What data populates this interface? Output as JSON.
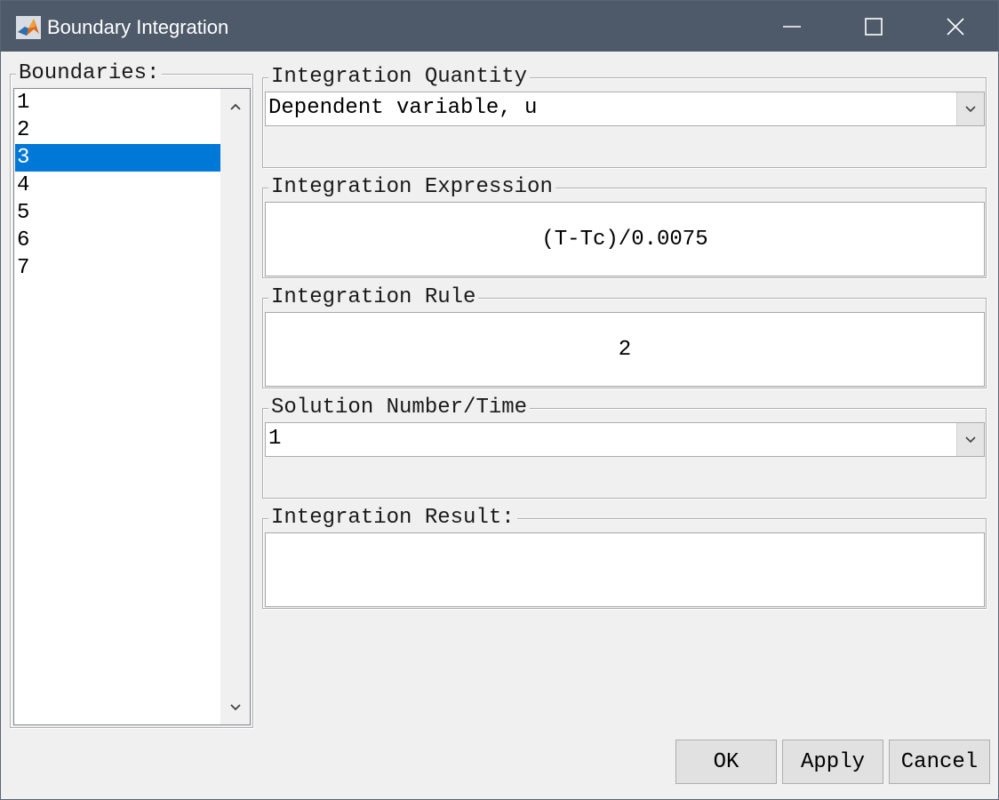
{
  "window": {
    "title": "Boundary Integration",
    "icon": "matlab-icon"
  },
  "boundaries": {
    "title": "Boundaries:",
    "items": [
      "1",
      "2",
      "3",
      "4",
      "5",
      "6",
      "7"
    ],
    "selected": "3"
  },
  "integration_quantity": {
    "title": "Integration Quantity",
    "value": "Dependent variable, u"
  },
  "integration_expression": {
    "title": "Integration Expression",
    "value": "(T-Tc)/0.0075"
  },
  "integration_rule": {
    "title": "Integration Rule",
    "value": "2"
  },
  "solution_number": {
    "title": "Solution Number/Time",
    "value": "1"
  },
  "integration_result": {
    "title": "Integration Result:",
    "value": ""
  },
  "buttons": {
    "ok": "OK",
    "apply": "Apply",
    "cancel": "Cancel"
  },
  "colors": {
    "titlebar": "#4e5a6a",
    "selection": "#0078d7",
    "background": "#f0f0f0"
  }
}
